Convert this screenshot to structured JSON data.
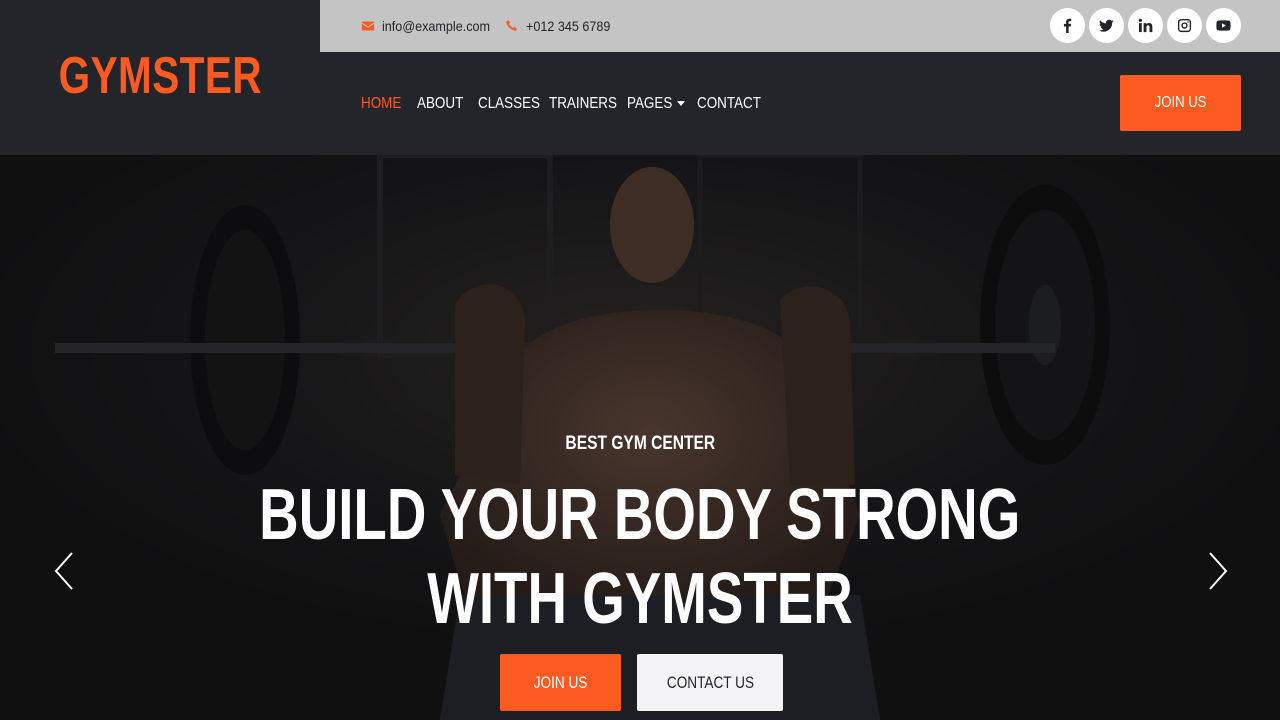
{
  "brand": {
    "name": "GYMSTER"
  },
  "topbar": {
    "email": "info@example.com",
    "phone": "+012 345 6789",
    "socials": [
      {
        "name": "facebook",
        "icon": "facebook-icon"
      },
      {
        "name": "twitter",
        "icon": "twitter-icon"
      },
      {
        "name": "linkedin",
        "icon": "linkedin-icon"
      },
      {
        "name": "instagram",
        "icon": "instagram-icon"
      },
      {
        "name": "youtube",
        "icon": "youtube-icon"
      }
    ]
  },
  "nav": {
    "items": [
      {
        "label": "HOME",
        "active": true
      },
      {
        "label": "ABOUT"
      },
      {
        "label": "CLASSES"
      },
      {
        "label": "TRAINERS"
      },
      {
        "label": "PAGES",
        "dropdown": true
      },
      {
        "label": "CONTACT"
      }
    ],
    "cta": "JOIN US"
  },
  "hero": {
    "subtitle": "BEST GYM CENTER",
    "title_line1": "BUILD YOUR BODY STRONG",
    "title_line2": "WITH GYMSTER",
    "primary_button": "JOIN US",
    "secondary_button": "CONTACT US",
    "image": "weightlifter-barbell-photo"
  },
  "colors": {
    "accent": "#fb5b21",
    "dark": "#23252b",
    "topbar": "#c4c4c4",
    "light_button": "#f4f4f6"
  }
}
